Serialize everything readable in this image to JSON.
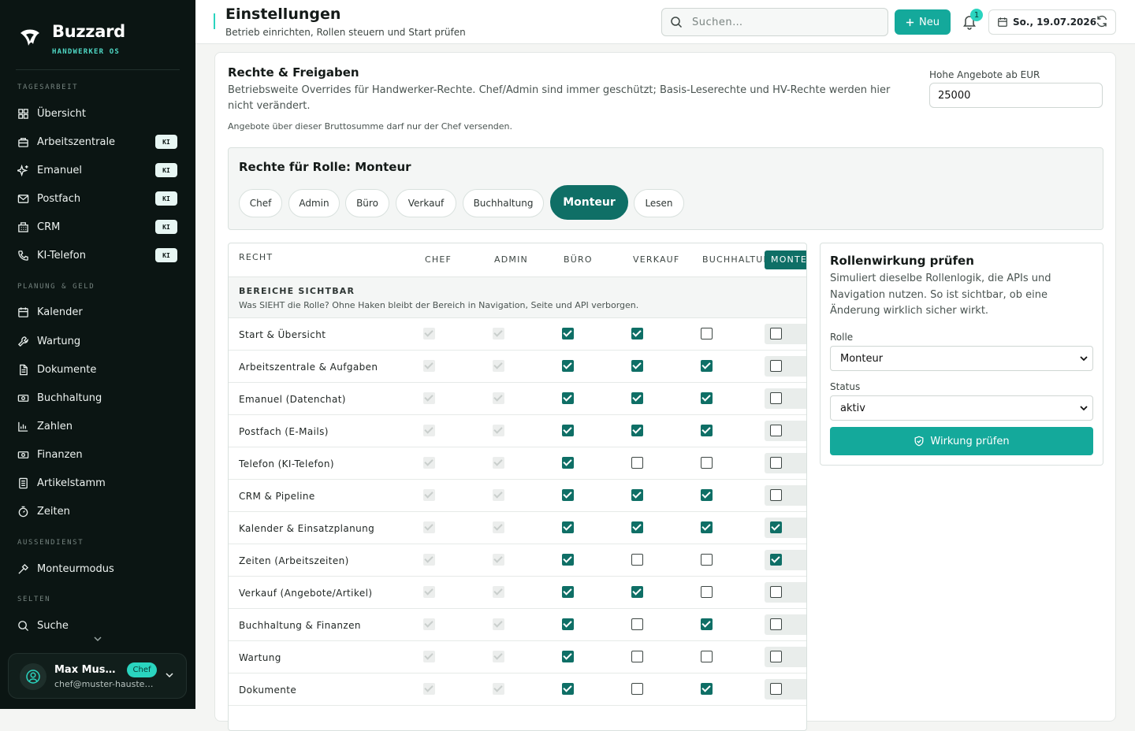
{
  "brand": {
    "name": "Buzzard",
    "subtitle": "HANDWERKER OS"
  },
  "sidebar": {
    "sections": [
      {
        "label": "TAGESARBEIT"
      },
      {
        "label": "PLANUNG & GELD"
      },
      {
        "label": "AUSSENDIENST"
      },
      {
        "label": "SELTEN"
      }
    ],
    "items": [
      {
        "label": "Übersicht",
        "icon": "grid-icon",
        "badge": ""
      },
      {
        "label": "Arbeitszentrale",
        "icon": "inbox-icon",
        "badge": "KI"
      },
      {
        "label": "Emanuel",
        "icon": "sparkle-icon",
        "badge": "KI"
      },
      {
        "label": "Postfach",
        "icon": "mail-icon",
        "badge": "KI"
      },
      {
        "label": "CRM",
        "icon": "building-icon",
        "badge": "KI"
      },
      {
        "label": "KI-Telefon",
        "icon": "phone-icon",
        "badge": "KI"
      },
      {
        "label": "Kalender",
        "icon": "calendar-icon",
        "badge": ""
      },
      {
        "label": "Wartung",
        "icon": "wrench-icon",
        "badge": ""
      },
      {
        "label": "Dokumente",
        "icon": "document-icon",
        "badge": ""
      },
      {
        "label": "Buchhaltung",
        "icon": "banknote-icon",
        "badge": ""
      },
      {
        "label": "Zahlen",
        "icon": "bar-chart-icon",
        "badge": ""
      },
      {
        "label": "Finanzen",
        "icon": "banknote-icon",
        "badge": ""
      },
      {
        "label": "Artikelstamm",
        "icon": "list-icon",
        "badge": ""
      },
      {
        "label": "Zeiten",
        "icon": "timer-icon",
        "badge": ""
      },
      {
        "label": "Monteurmodus",
        "icon": "hammer-icon",
        "badge": ""
      },
      {
        "label": "Suche",
        "icon": "search-icon",
        "badge": ""
      }
    ]
  },
  "user": {
    "name": "Max Mus…",
    "email": "chef@muster-hauste…",
    "role": "Chef"
  },
  "header": {
    "title": "Einstellungen",
    "subtitle": "Betrieb einrichten, Rollen steuern und Start prüfen",
    "search_placeholder": "Suchen…",
    "new_label": "Neu",
    "notifications": "1",
    "date": "So., 19.07.2026"
  },
  "rights": {
    "title": "Rechte & Freigaben",
    "description": "Betriebsweite Overrides für Handwerker-Rechte. Chef/Admin sind immer geschützt; Basis-Leserechte und HV-Rechte werden hier nicht verändert.",
    "note": "Angebote über dieser Bruttosumme darf nur der Chef versenden.",
    "threshold_label": "Hohe Angebote ab EUR",
    "threshold_value": "25000"
  },
  "role_picker": {
    "title": "Rechte für Rolle: Monteur",
    "roles": [
      "Chef",
      "Admin",
      "Büro",
      "Verkauf",
      "Buchhaltung",
      "Monteur",
      "Lesen"
    ],
    "active": "Monteur"
  },
  "table": {
    "headers": [
      "RECHT",
      "CHEF",
      "ADMIN",
      "BÜRO",
      "VERKAUF",
      "BUCHHALTUNG",
      "MONTEUR"
    ],
    "group_title": "BEREICHE SICHTBAR",
    "group_desc": "Was SIEHT die Rolle? Ohne Haken bleibt der Bereich in Navigation, Seite und API verborgen.",
    "rows": [
      {
        "label": "Start & Übersicht",
        "values": [
          "locked",
          "locked",
          "on",
          "on",
          "off",
          "off"
        ]
      },
      {
        "label": "Arbeitszentrale & Aufgaben",
        "values": [
          "locked",
          "locked",
          "on",
          "on",
          "on",
          "off"
        ]
      },
      {
        "label": "Emanuel (Datenchat)",
        "values": [
          "locked",
          "locked",
          "on",
          "on",
          "on",
          "off"
        ]
      },
      {
        "label": "Postfach (E-Mails)",
        "values": [
          "locked",
          "locked",
          "on",
          "on",
          "on",
          "off"
        ]
      },
      {
        "label": "Telefon (KI-Telefon)",
        "values": [
          "locked",
          "locked",
          "on",
          "off",
          "off",
          "off"
        ]
      },
      {
        "label": "CRM & Pipeline",
        "values": [
          "locked",
          "locked",
          "on",
          "on",
          "on",
          "off"
        ]
      },
      {
        "label": "Kalender & Einsatzplanung",
        "values": [
          "locked",
          "locked",
          "on",
          "on",
          "on",
          "on"
        ]
      },
      {
        "label": "Zeiten (Arbeitszeiten)",
        "values": [
          "locked",
          "locked",
          "on",
          "off",
          "off",
          "on"
        ]
      },
      {
        "label": "Verkauf (Angebote/Artikel)",
        "values": [
          "locked",
          "locked",
          "on",
          "on",
          "off",
          "off"
        ]
      },
      {
        "label": "Buchhaltung & Finanzen",
        "values": [
          "locked",
          "locked",
          "on",
          "off",
          "on",
          "off"
        ]
      },
      {
        "label": "Wartung",
        "values": [
          "locked",
          "locked",
          "on",
          "off",
          "off",
          "off"
        ]
      },
      {
        "label": "Dokumente",
        "values": [
          "locked",
          "locked",
          "on",
          "off",
          "on",
          "off"
        ]
      }
    ]
  },
  "simulate": {
    "title": "Rollenwirkung prüfen",
    "description": "Simuliert dieselbe Rollenlogik, die APIs und Navigation nutzen. So ist sichtbar, ob eine Änderung wirklich sicher wirkt.",
    "role_label": "Rolle",
    "role_value": "Monteur",
    "status_label": "Status",
    "status_value": "aktiv",
    "button": "Wirkung prüfen"
  },
  "colors": {
    "accent": "#2ad4bf",
    "primary": "#14a99b",
    "dark_teal": "#0f6f66",
    "sidebar": "#0b1513"
  }
}
